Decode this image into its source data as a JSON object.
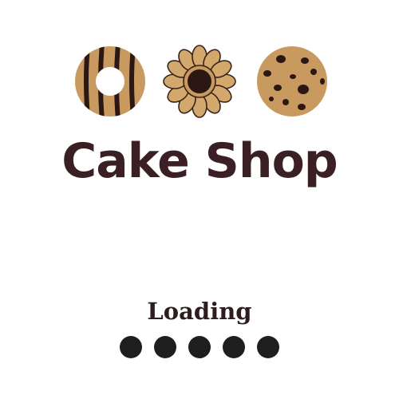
{
  "brand": {
    "name": "Cake Shop",
    "color": "#3a1f24"
  },
  "logo": {
    "icons": [
      "striped-ring-cookie-icon",
      "butter-flower-cookie-icon",
      "chocolate-chip-cookie-icon"
    ],
    "cookie_color": "#c99a5f",
    "chocolate_color": "#2b1714"
  },
  "loader": {
    "label": "Loading",
    "dot_count": 5,
    "dot_color": "#1e1e1e"
  }
}
